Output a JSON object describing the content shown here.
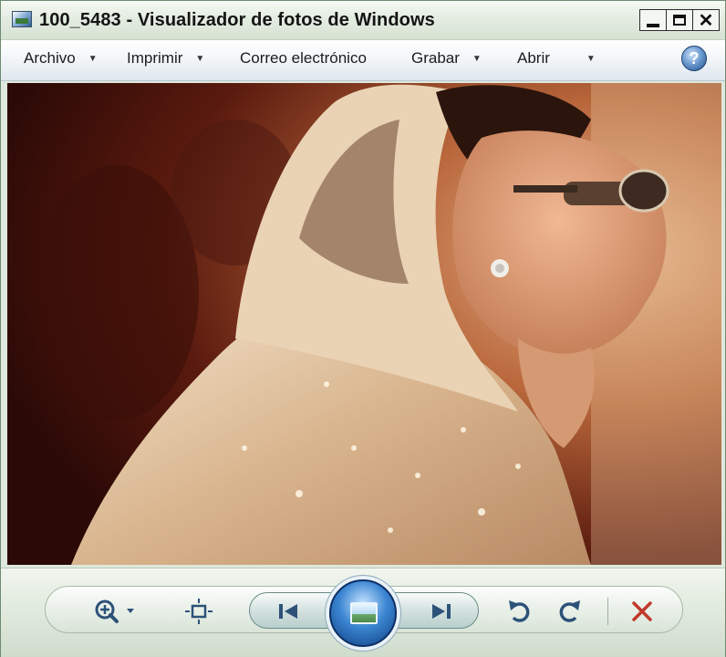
{
  "window": {
    "title": "100_5483 - Visualizador de fotos de Windows",
    "caption_buttons": {
      "minimize": "_",
      "maximize": "□",
      "close": "✕"
    }
  },
  "menu": {
    "items": [
      {
        "label": "Archivo",
        "has_dropdown": true
      },
      {
        "label": "Imprimir",
        "has_dropdown": true
      },
      {
        "label": "Correo electrónico",
        "has_dropdown": false
      },
      {
        "label": "Grabar",
        "has_dropdown": true
      },
      {
        "label": "Abrir",
        "has_dropdown": true
      }
    ],
    "help_label": "?"
  },
  "controls": {
    "zoom": "magnifier-zoom-icon",
    "fit": "fit-to-window-icon",
    "previous": "previous-icon",
    "slideshow": "slideshow-icon",
    "next": "next-icon",
    "rotate_ccw": "rotate-counterclockwise-icon",
    "rotate_cw": "rotate-clockwise-icon",
    "delete": "delete-icon"
  },
  "colors": {
    "accent_blue": "#2d5279",
    "delete_red": "#c0392b"
  }
}
